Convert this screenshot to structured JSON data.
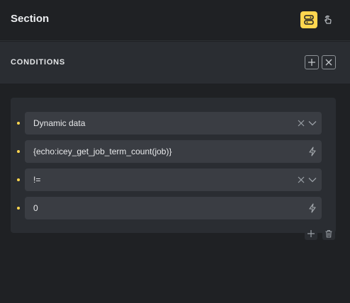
{
  "header": {
    "title": "Section",
    "icons": {
      "active": "style-toggle-icon",
      "inactive": "cursor-hand-icon"
    },
    "accent": "#ffd64f"
  },
  "conditions": {
    "label": "CONDITIONS",
    "rows": [
      {
        "value": "Dynamic data",
        "type": "select"
      },
      {
        "value": "{echo:icey_get_job_term_count(job)}",
        "type": "dynamic"
      },
      {
        "value": "!=",
        "type": "select"
      },
      {
        "value": "0",
        "type": "dynamic"
      }
    ]
  }
}
